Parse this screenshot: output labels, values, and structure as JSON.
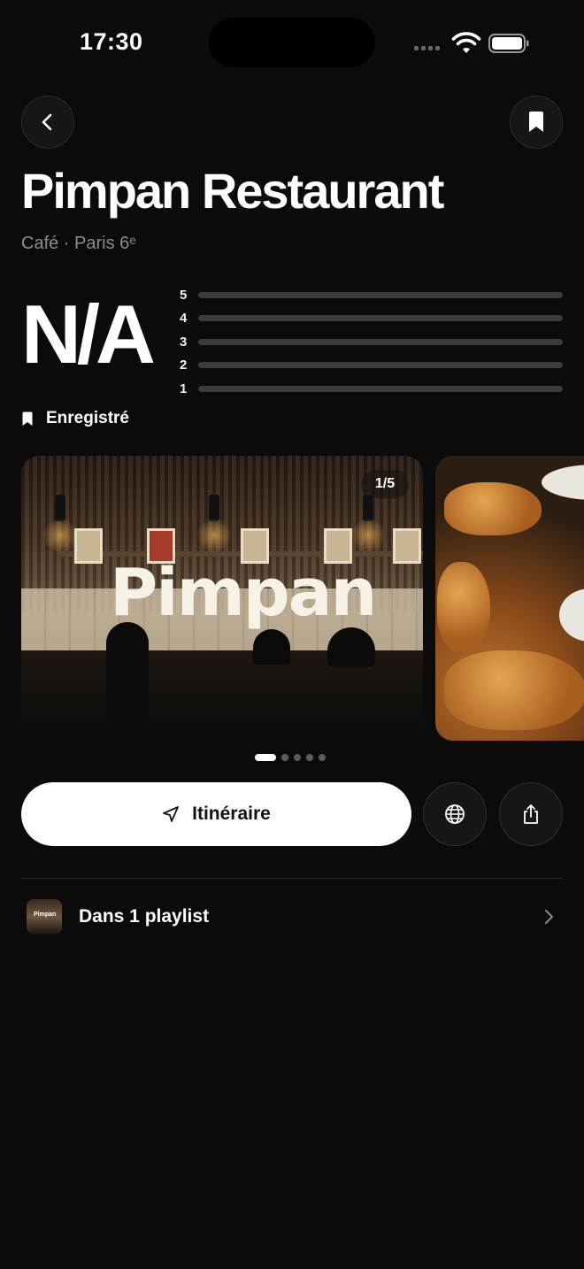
{
  "status_bar": {
    "time": "17:30",
    "icons": [
      "cellular-signal-icon",
      "wifi-icon",
      "battery-icon"
    ]
  },
  "nav": {
    "back_icon": "chevron-left-icon",
    "bookmark_icon": "bookmark-icon"
  },
  "place": {
    "name": "Pimpan Restaurant",
    "subtitle": "Café · Paris 6ᵉ"
  },
  "rating": {
    "value": "N/A",
    "distribution": [
      {
        "label": "5",
        "fraction": 0
      },
      {
        "label": "4",
        "fraction": 0
      },
      {
        "label": "3",
        "fraction": 0
      },
      {
        "label": "2",
        "fraction": 0
      },
      {
        "label": "1",
        "fraction": 0
      }
    ]
  },
  "saved": {
    "label": "Enregistré",
    "icon": "bookmark-icon"
  },
  "gallery": {
    "counter": "1/5",
    "logo_text": "Pimpan",
    "total": 5,
    "current": 1
  },
  "actions": {
    "route_label": "Itinéraire",
    "route_icon": "navigation-arrow-icon",
    "web_icon": "globe-icon",
    "share_icon": "share-icon"
  },
  "playlist": {
    "label": "Dans 1 playlist",
    "thumb_text": "Pimpan"
  },
  "colors": {
    "background": "#0b0b0b",
    "surface": "#161616",
    "text_primary": "#ffffff",
    "text_secondary": "#8d8d8d",
    "primary_button": "#ffffff"
  }
}
